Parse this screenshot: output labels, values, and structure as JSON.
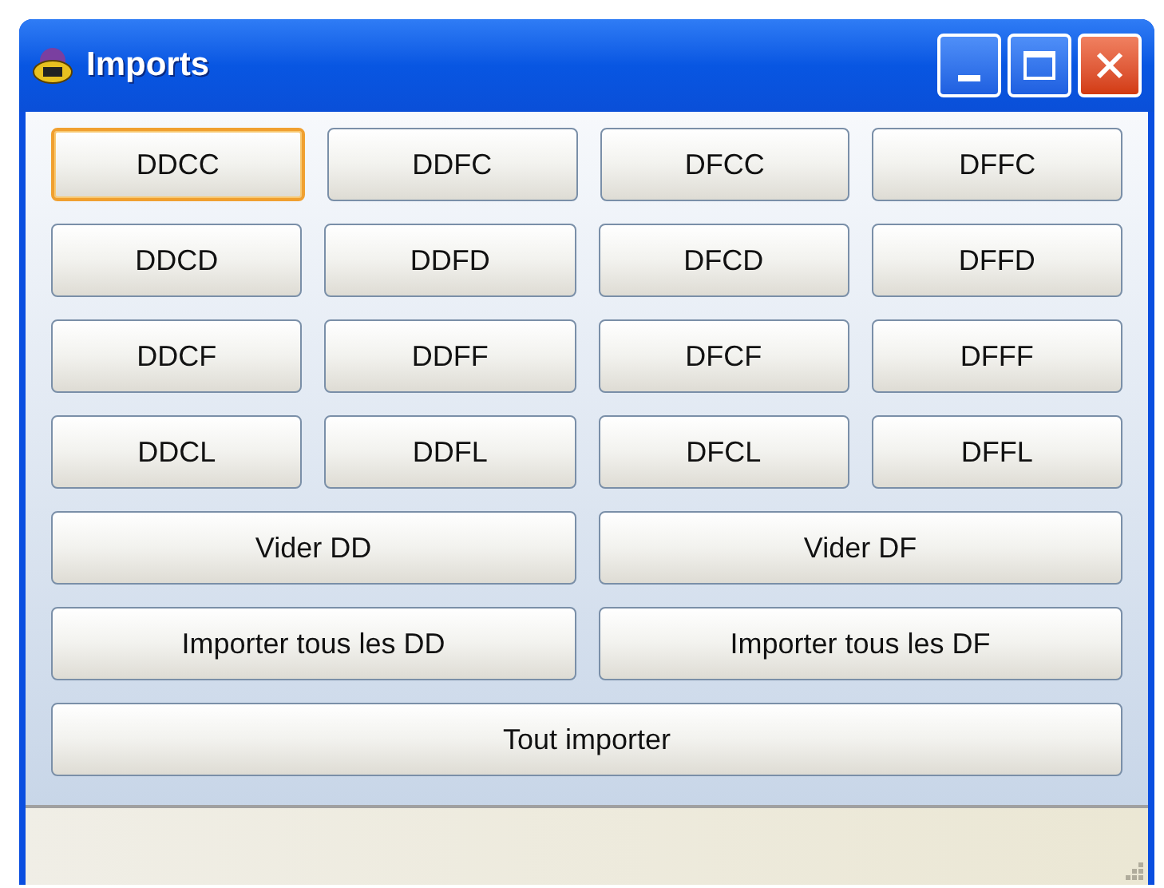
{
  "window": {
    "title": "Imports"
  },
  "button_rows": [
    [
      {
        "label": "DDCC",
        "focused": true
      },
      {
        "label": "DDFC",
        "focused": false
      },
      {
        "label": "DFCC",
        "focused": false
      },
      {
        "label": "DFFC",
        "focused": false
      }
    ],
    [
      {
        "label": "DDCD",
        "focused": false
      },
      {
        "label": "DDFD",
        "focused": false
      },
      {
        "label": "DFCD",
        "focused": false
      },
      {
        "label": "DFFD",
        "focused": false
      }
    ],
    [
      {
        "label": "DDCF",
        "focused": false
      },
      {
        "label": "DDFF",
        "focused": false
      },
      {
        "label": "DFCF",
        "focused": false
      },
      {
        "label": "DFFF",
        "focused": false
      }
    ],
    [
      {
        "label": "DDCL",
        "focused": false
      },
      {
        "label": "DDFL",
        "focused": false
      },
      {
        "label": "DFCL",
        "focused": false
      },
      {
        "label": "DFFL",
        "focused": false
      }
    ],
    [
      {
        "label": "Vider DD",
        "focused": false
      },
      {
        "label": "Vider DF",
        "focused": false
      }
    ],
    [
      {
        "label": "Importer tous les DD",
        "focused": false
      },
      {
        "label": "Importer tous les DF",
        "focused": false
      }
    ],
    [
      {
        "label": "Tout importer",
        "focused": false
      }
    ]
  ]
}
